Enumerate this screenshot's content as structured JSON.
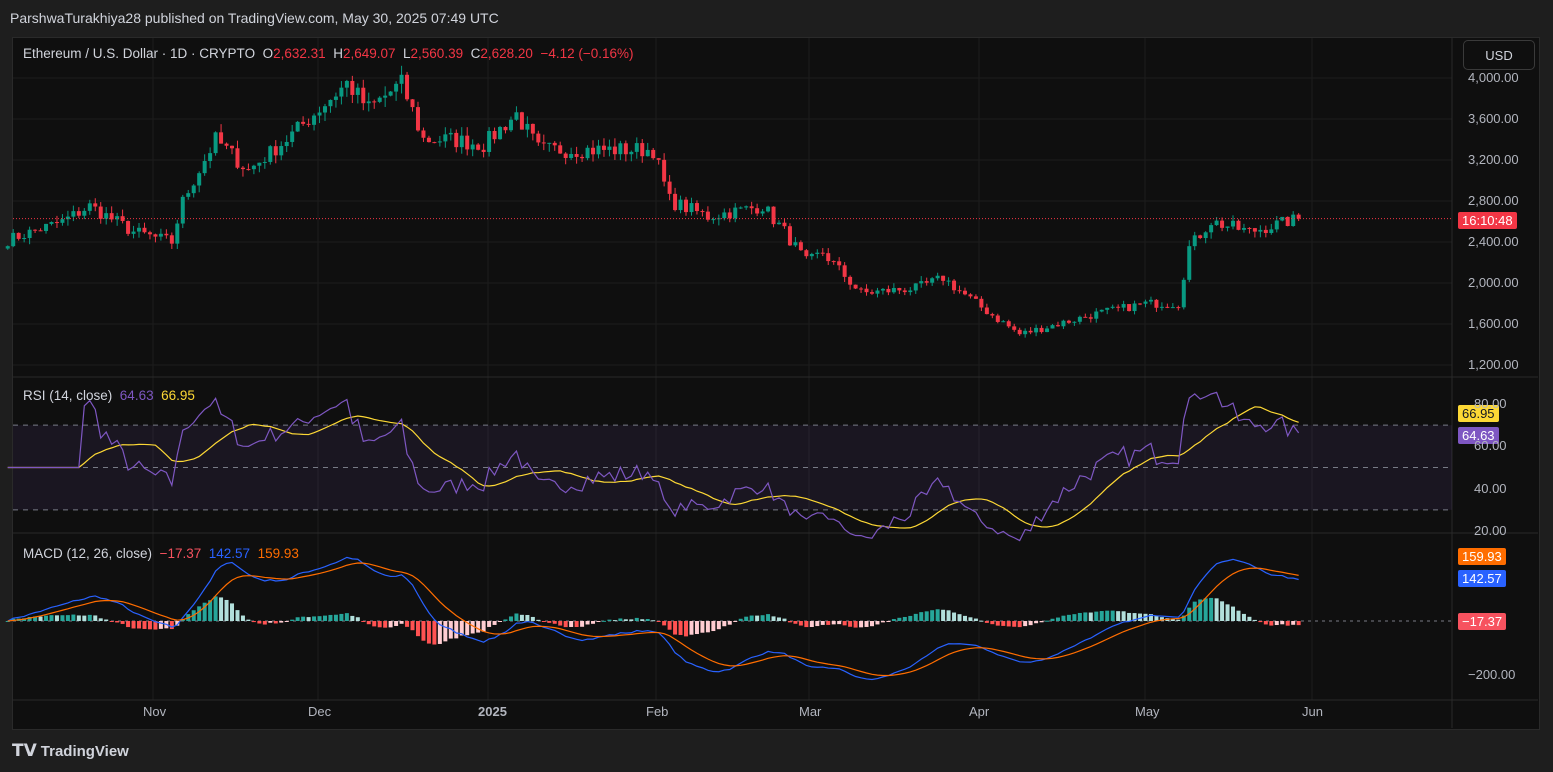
{
  "publisher": "ParshwaTurakhiya28 published on TradingView.com, May 30, 2025 07:49 UTC",
  "legend": {
    "symbol": "Ethereum / U.S. Dollar · 1D · CRYPTO",
    "o_label": "O",
    "o": "2,632.31",
    "h_label": "H",
    "h": "2,649.07",
    "l_label": "L",
    "l": "2,560.39",
    "c_label": "C",
    "c": "2,628.20",
    "change": "−4.12 (−0.16%)"
  },
  "currency_button": "USD",
  "countdown": "16:10:48",
  "rsi": {
    "label": "RSI (14, close)",
    "value": "64.63",
    "ma": "66.95"
  },
  "macd": {
    "label": "MACD (12, 26, close)",
    "hist": "−17.37",
    "macd": "142.57",
    "signal": "159.93"
  },
  "footer": "TradingView",
  "colors": {
    "up": "#089981",
    "down": "#f23645",
    "rsi": "#7e57c2",
    "rsi_ma": "#fdd835",
    "macd": "#2962ff",
    "signal": "#ff6d00"
  },
  "chart_data": {
    "type": "candlestick",
    "title": "Ethereum / U.S. Dollar · 1D",
    "price_ticks": [
      "4,000.00",
      "3,600.00",
      "3,200.00",
      "2,800.00",
      "2,400.00",
      "2,000.00",
      "1,600.00",
      "1,200.00"
    ],
    "price_range": [
      1200,
      4000
    ],
    "rsi_ticks": [
      "80.00",
      "60.00",
      "40.00",
      "20.00"
    ],
    "macd_ticks": [
      "−200.00"
    ],
    "x_ticks": [
      "Nov",
      "Dec",
      "2025",
      "Feb",
      "Mar",
      "Apr",
      "May",
      "Jun"
    ],
    "start_date": "2024-10-05",
    "close_waypoints": [
      [
        0,
        2420
      ],
      [
        10,
        2600
      ],
      [
        15,
        2750
      ],
      [
        23,
        2500
      ],
      [
        30,
        2400
      ],
      [
        32,
        2800
      ],
      [
        36,
        3200
      ],
      [
        38,
        3400
      ],
      [
        44,
        3100
      ],
      [
        51,
        3400
      ],
      [
        57,
        3700
      ],
      [
        62,
        3950
      ],
      [
        66,
        3700
      ],
      [
        72,
        3950
      ],
      [
        76,
        3400
      ],
      [
        81,
        3400
      ],
      [
        87,
        3350
      ],
      [
        93,
        3650
      ],
      [
        97,
        3300
      ],
      [
        107,
        3300
      ],
      [
        118,
        3300
      ],
      [
        121,
        2800
      ],
      [
        128,
        2650
      ],
      [
        138,
        2750
      ],
      [
        142,
        2500
      ],
      [
        146,
        2200
      ],
      [
        149,
        2300
      ],
      [
        156,
        1900
      ],
      [
        166,
        1950
      ],
      [
        171,
        2050
      ],
      [
        177,
        1800
      ],
      [
        185,
        1500
      ],
      [
        192,
        1600
      ],
      [
        199,
        1700
      ],
      [
        208,
        1800
      ],
      [
        214,
        1800
      ],
      [
        216,
        2350
      ],
      [
        220,
        2600
      ],
      [
        227,
        2500
      ],
      [
        236,
        2628
      ]
    ]
  }
}
